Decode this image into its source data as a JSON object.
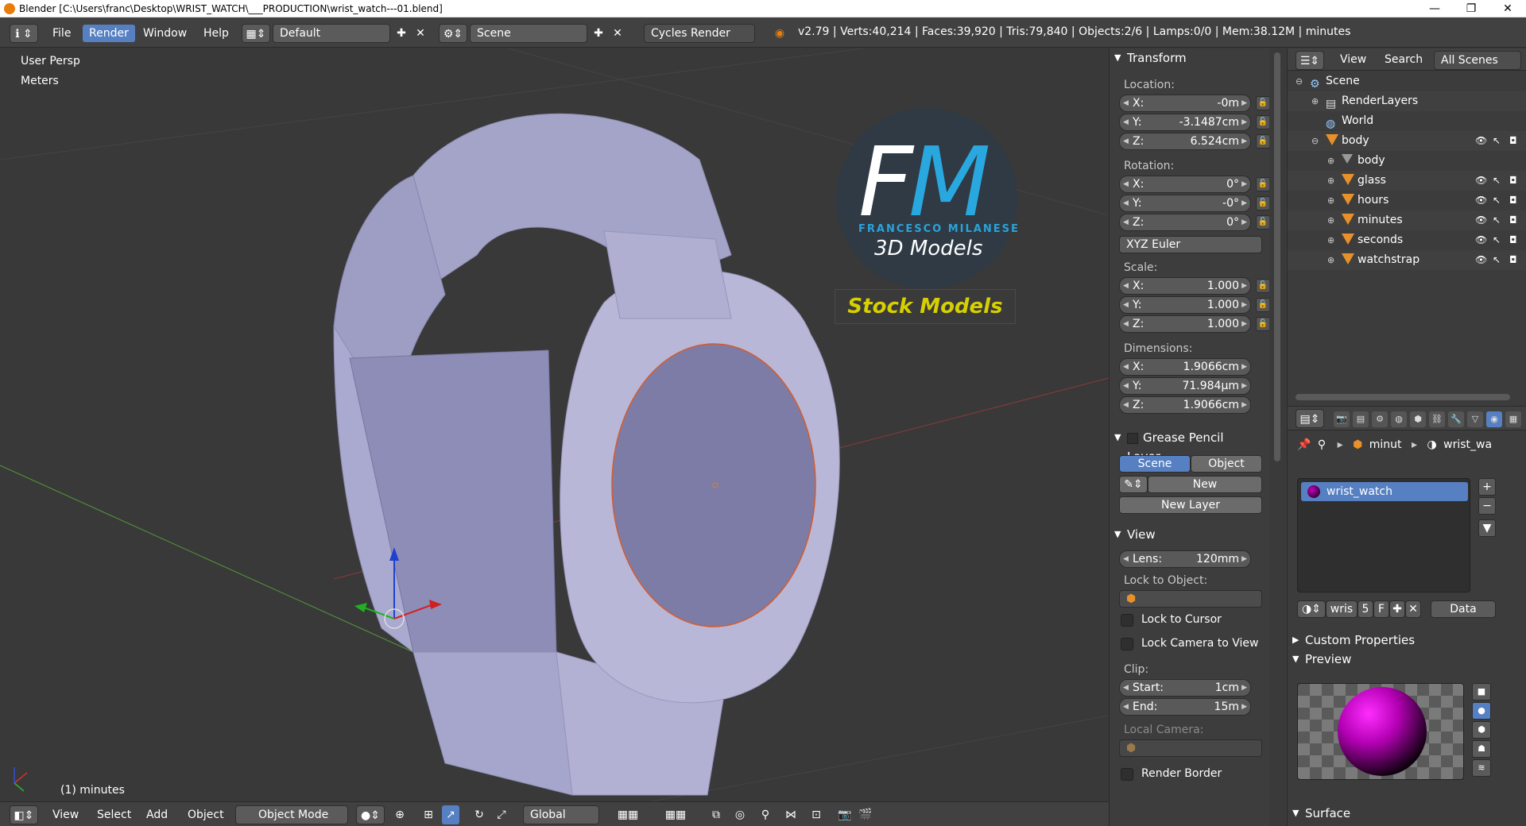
{
  "window": {
    "title": "Blender [C:\\Users\\franc\\Desktop\\WRIST_WATCH\\___PRODUCTION\\wrist_watch---01.blend]",
    "minimize": "—",
    "maximize": "❐",
    "close": "✕"
  },
  "info_header": {
    "menu": [
      "File",
      "Render",
      "Window",
      "Help"
    ],
    "layout": "Default",
    "scene": "Scene",
    "engine": "Cycles Render",
    "stats": "v2.79 | Verts:40,214 | Faces:39,920 | Tris:79,840 | Objects:2/6 | Lamps:0/0 | Mem:38.12M | minutes"
  },
  "viewport": {
    "view_name": "User Persp",
    "units": "Meters",
    "active_object": "(1) minutes",
    "logo_fm_a": "F",
    "logo_fm_b": "M",
    "logo_name": "FRANCESCO MILANESE",
    "logo_sub": "3D Models",
    "logo_stock": "Stock Models"
  },
  "viewport_header": {
    "menu": [
      "View",
      "Select",
      "Add",
      "Object"
    ],
    "mode": "Object Mode",
    "orientation": "Global"
  },
  "transform": {
    "title": "Transform",
    "location_label": "Location:",
    "location": [
      {
        "axis": "X:",
        "value": "-0m"
      },
      {
        "axis": "Y:",
        "value": "-3.1487cm"
      },
      {
        "axis": "Z:",
        "value": "6.524cm"
      }
    ],
    "rotation_label": "Rotation:",
    "rotation": [
      {
        "axis": "X:",
        "value": "0°"
      },
      {
        "axis": "Y:",
        "value": "-0°"
      },
      {
        "axis": "Z:",
        "value": "0°"
      }
    ],
    "rotation_mode": "XYZ Euler",
    "scale_label": "Scale:",
    "scale": [
      {
        "axis": "X:",
        "value": "1.000"
      },
      {
        "axis": "Y:",
        "value": "1.000"
      },
      {
        "axis": "Z:",
        "value": "1.000"
      }
    ],
    "dimensions_label": "Dimensions:",
    "dimensions": [
      {
        "axis": "X:",
        "value": "1.9066cm"
      },
      {
        "axis": "Y:",
        "value": "71.984µm"
      },
      {
        "axis": "Z:",
        "value": "1.9066cm"
      }
    ]
  },
  "grease_pencil": {
    "title": "Grease Pencil Layer",
    "tab_scene": "Scene",
    "tab_object": "Object",
    "new_label": "New",
    "new_layer_label": "New Layer"
  },
  "view_panel": {
    "title": "View",
    "lens_label": "Lens:",
    "lens_value": "120mm",
    "lock_to_object": "Lock to Object:",
    "lock_to_cursor": "Lock to Cursor",
    "lock_camera_to_view": "Lock Camera to View",
    "clip_label": "Clip:",
    "clip_start_label": "Start:",
    "clip_start": "1cm",
    "clip_end_label": "End:",
    "clip_end": "15m",
    "local_camera": "Local Camera:",
    "render_border": "Render Border"
  },
  "outliner": {
    "view": "View",
    "search": "Search",
    "filter": "All Scenes",
    "items": [
      {
        "label": "Scene"
      },
      {
        "label": "RenderLayers"
      },
      {
        "label": "World"
      },
      {
        "label": "body"
      },
      {
        "label": "body"
      },
      {
        "label": "glass"
      },
      {
        "label": "hours"
      },
      {
        "label": "minutes"
      },
      {
        "label": "seconds"
      },
      {
        "label": "watchstrap"
      }
    ]
  },
  "properties": {
    "breadcrumb_obj": "minut",
    "breadcrumb_mat": "wrist_wa",
    "material_item": "wrist_watch",
    "mat_name_short": "wris",
    "users": "5",
    "fake": "F",
    "link": "Data",
    "custom_properties": "Custom Properties",
    "preview": "Preview",
    "surface": "Surface"
  },
  "colors": {
    "accent": "#5680c2",
    "orange": "#e8902a",
    "bg": "#393939"
  }
}
